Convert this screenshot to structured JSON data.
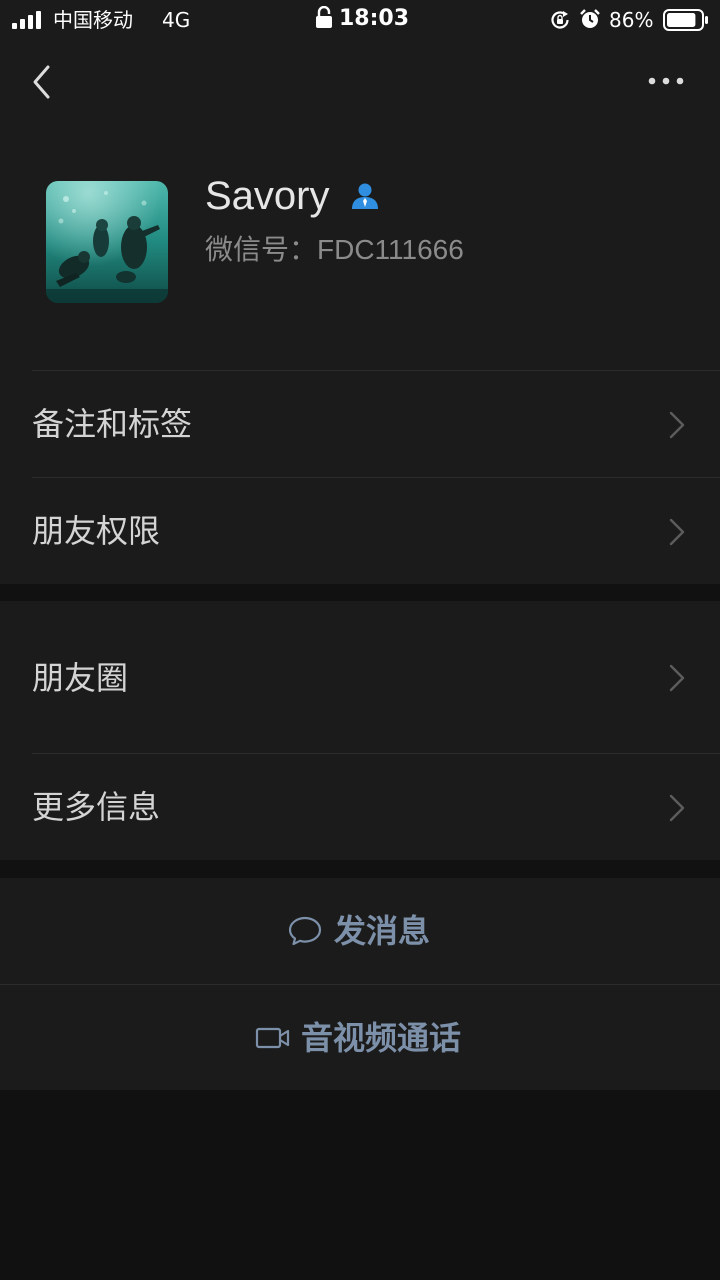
{
  "status_bar": {
    "carrier": "中国移动",
    "network": "4G",
    "time": "18:03",
    "battery_percent": "86%",
    "battery_level": 0.86
  },
  "nav": {
    "back_icon": "chevron-left-icon",
    "more_icon": "more-dots-icon"
  },
  "profile": {
    "name": "Savory",
    "wechat_id": "微信号：FDC111666",
    "badge_icon": "person-icon"
  },
  "menu": {
    "group1": [
      {
        "label": "备注和标签"
      },
      {
        "label": "朋友权限"
      }
    ],
    "group2": [
      {
        "label": "朋友圈"
      },
      {
        "label": "更多信息"
      }
    ]
  },
  "actions": {
    "send_message": "发消息",
    "video_call": "音视频通话"
  },
  "colors": {
    "background": "#111111",
    "card": "#1b1b1b",
    "action_text": "#7d90a9",
    "badge_blue": "#2f8ee0"
  }
}
